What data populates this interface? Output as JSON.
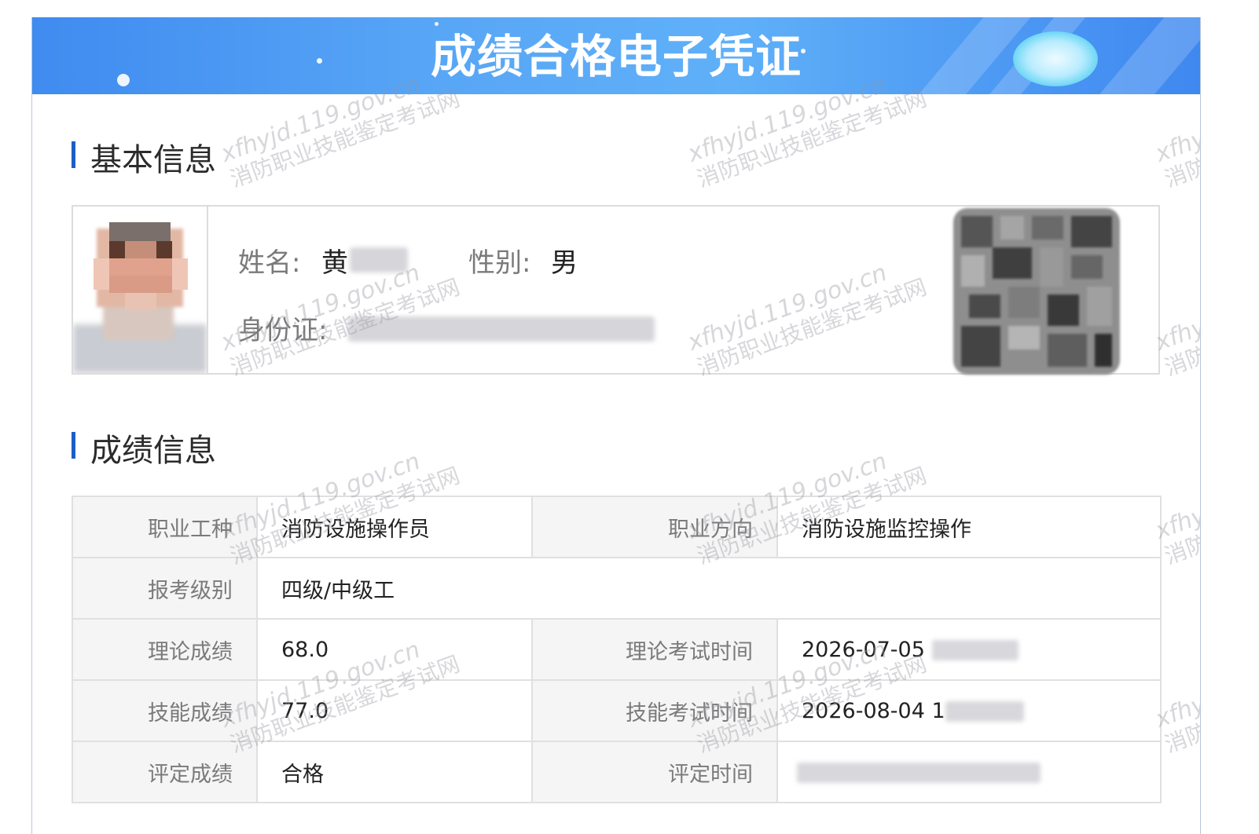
{
  "banner": {
    "title": "成绩合格电子凭证"
  },
  "sections": {
    "basic": "基本信息",
    "score": "成绩信息"
  },
  "basic": {
    "name_label": "姓名:",
    "name_value": "黄",
    "gender_label": "性别:",
    "gender_value": "男",
    "id_label": "身份证:"
  },
  "scores": {
    "occupation_label": "职业工种",
    "occupation_value": "消防设施操作员",
    "direction_label": "职业方向",
    "direction_value": "消防设施监控操作",
    "level_label": "报考级别",
    "level_value": "四级/中级工",
    "theory_label": "理论成绩",
    "theory_value": "68.0",
    "theory_time_label": "理论考试时间",
    "theory_time_value": "2026-07-05",
    "skill_label": "技能成绩",
    "skill_value": "77.0",
    "skill_time_label": "技能考试时间",
    "skill_time_value": "2026-08-04 1",
    "eval_label": "评定成绩",
    "eval_value": "合格",
    "eval_time_label": "评定时间"
  },
  "watermark": {
    "domain": "xfhyjd.119.gov.cn",
    "site": "消防职业技能鉴定考试网"
  },
  "colors": {
    "banner": "#4a98f2",
    "accent": "#1d5ec7",
    "link_blue": "#2f80ed",
    "pass_green": "#1a9b3c"
  }
}
